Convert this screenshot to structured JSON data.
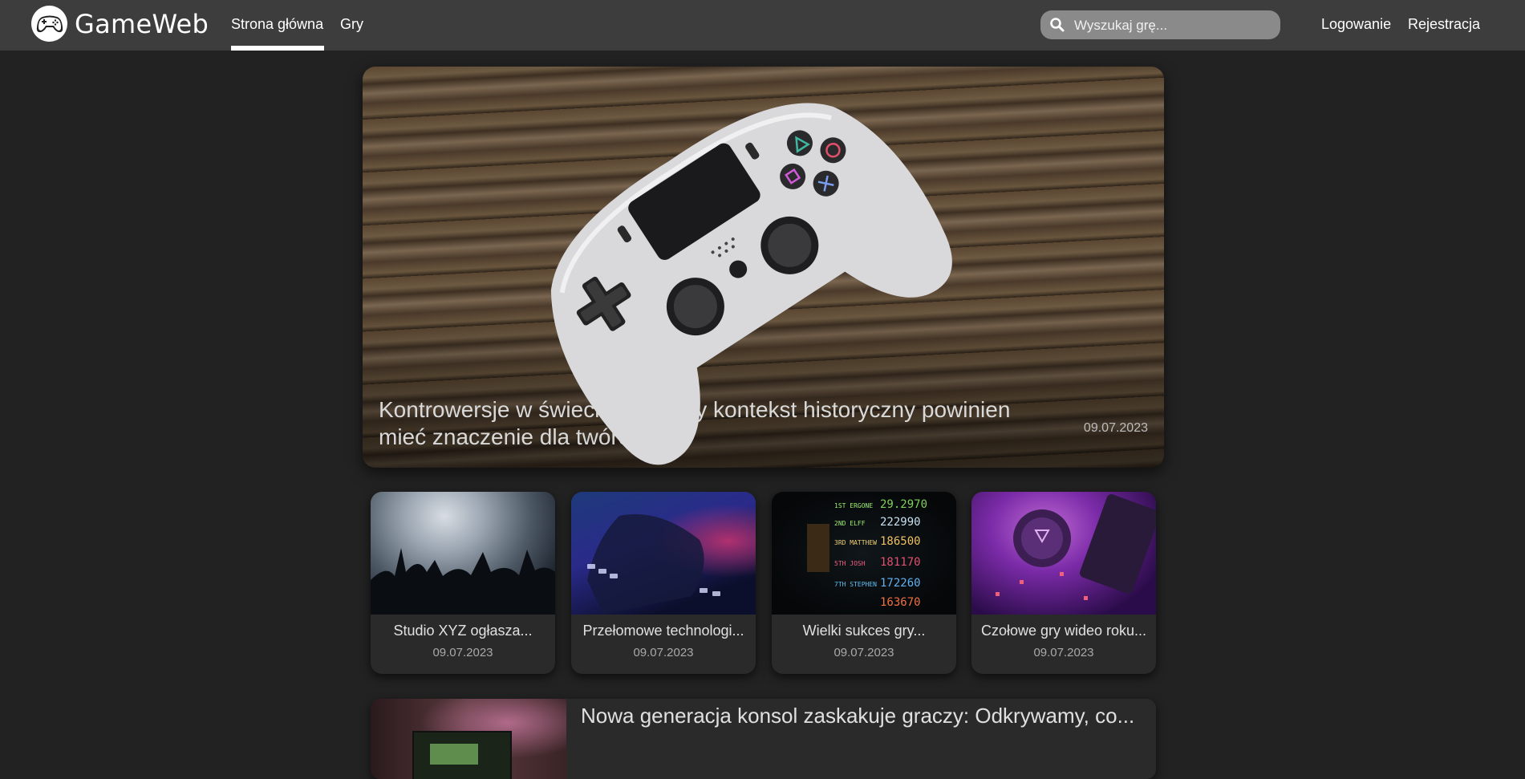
{
  "header": {
    "brand": "GameWeb",
    "nav": [
      {
        "label": "Strona główna",
        "active": true
      },
      {
        "label": "Gry",
        "active": false
      }
    ],
    "search": {
      "placeholder": "Wyszukaj grę..."
    },
    "auth": {
      "login": "Logowanie",
      "register": "Rejestracja"
    }
  },
  "hero": {
    "title": "Kontrowersje w świecie gier: Czy kontekst historyczny powinien mieć znaczenie dla twórców?",
    "date": "09.07.2023"
  },
  "cards": [
    {
      "title": "Studio XYZ ogłasza...",
      "date": "09.07.2023"
    },
    {
      "title": "Przełomowe technologi...",
      "date": "09.07.2023"
    },
    {
      "title": "Wielki sukces gry...",
      "date": "09.07.2023"
    },
    {
      "title": "Czołowe gry wideo roku...",
      "date": "09.07.2023"
    }
  ],
  "list": [
    {
      "title": "Nowa generacja konsol zaskakuje graczy: Odkrywamy, co..."
    }
  ],
  "colors": {
    "background": "#222222",
    "topbar": "#3d3d3d",
    "card": "#2a2a2a",
    "search": "#8a8a8a"
  }
}
